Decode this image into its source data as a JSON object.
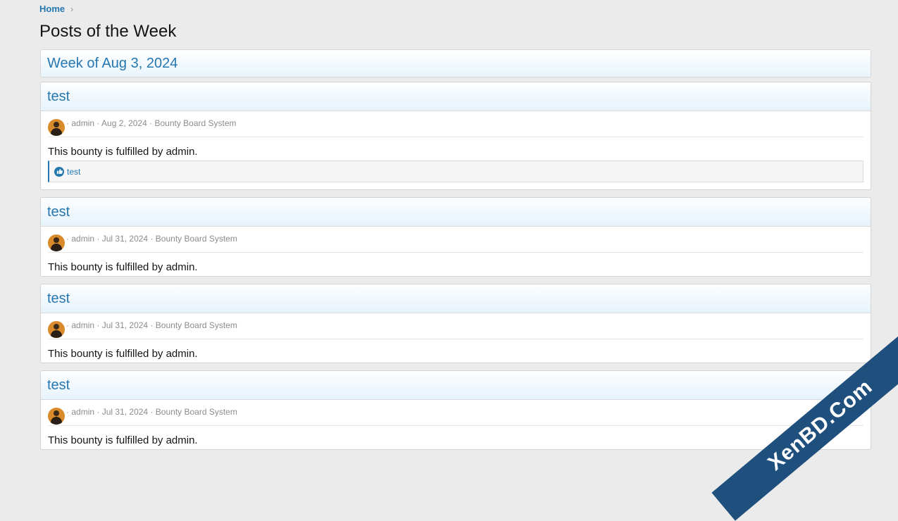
{
  "breadcrumb": {
    "home": "Home",
    "chevron": "›"
  },
  "page_title": "Posts of the Week",
  "week_title": "Week of Aug 3, 2024",
  "posts": [
    {
      "title": "test",
      "author": "admin",
      "date": "Aug 2, 2024",
      "forum": "Bounty Board System",
      "content": "This bounty is fulfilled by admin.",
      "reaction": "test"
    },
    {
      "title": "test",
      "author": "admin",
      "date": "Jul 31, 2024",
      "forum": "Bounty Board System",
      "content": "This bounty is fulfilled by admin."
    },
    {
      "title": "test",
      "author": "admin",
      "date": "Jul 31, 2024",
      "forum": "Bounty Board System",
      "content": "This bounty is fulfilled by admin."
    },
    {
      "title": "test",
      "author": "admin",
      "date": "Jul 31, 2024",
      "forum": "Bounty Board System",
      "content": "This bounty is fulfilled by admin."
    }
  ],
  "separator": "·",
  "watermark": "XenBD.Com",
  "colors": {
    "accent": "#2577b1",
    "background": "#ebebeb",
    "watermark": "#1e4f7d"
  }
}
